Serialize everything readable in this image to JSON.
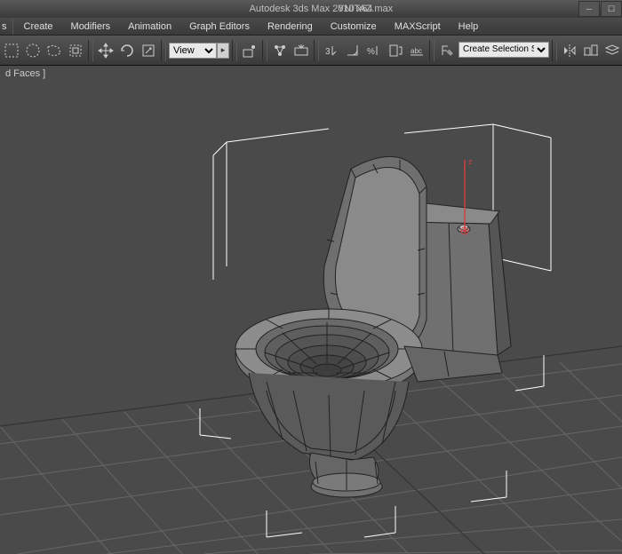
{
  "titlebar": {
    "app_title": "Autodesk 3ds Max  2010 x64",
    "file_name": "YNITAZ.max"
  },
  "menubar": {
    "edge_item": "s",
    "items": [
      "Create",
      "Modifiers",
      "Animation",
      "Graph Editors",
      "Rendering",
      "Customize",
      "MAXScript",
      "Help"
    ]
  },
  "toolbar": {
    "view_label": "View",
    "selection_set_label": "Create Selection Se"
  },
  "status": {
    "text": "d Faces ]"
  },
  "viewport": {
    "gizmo_axis": "z"
  }
}
